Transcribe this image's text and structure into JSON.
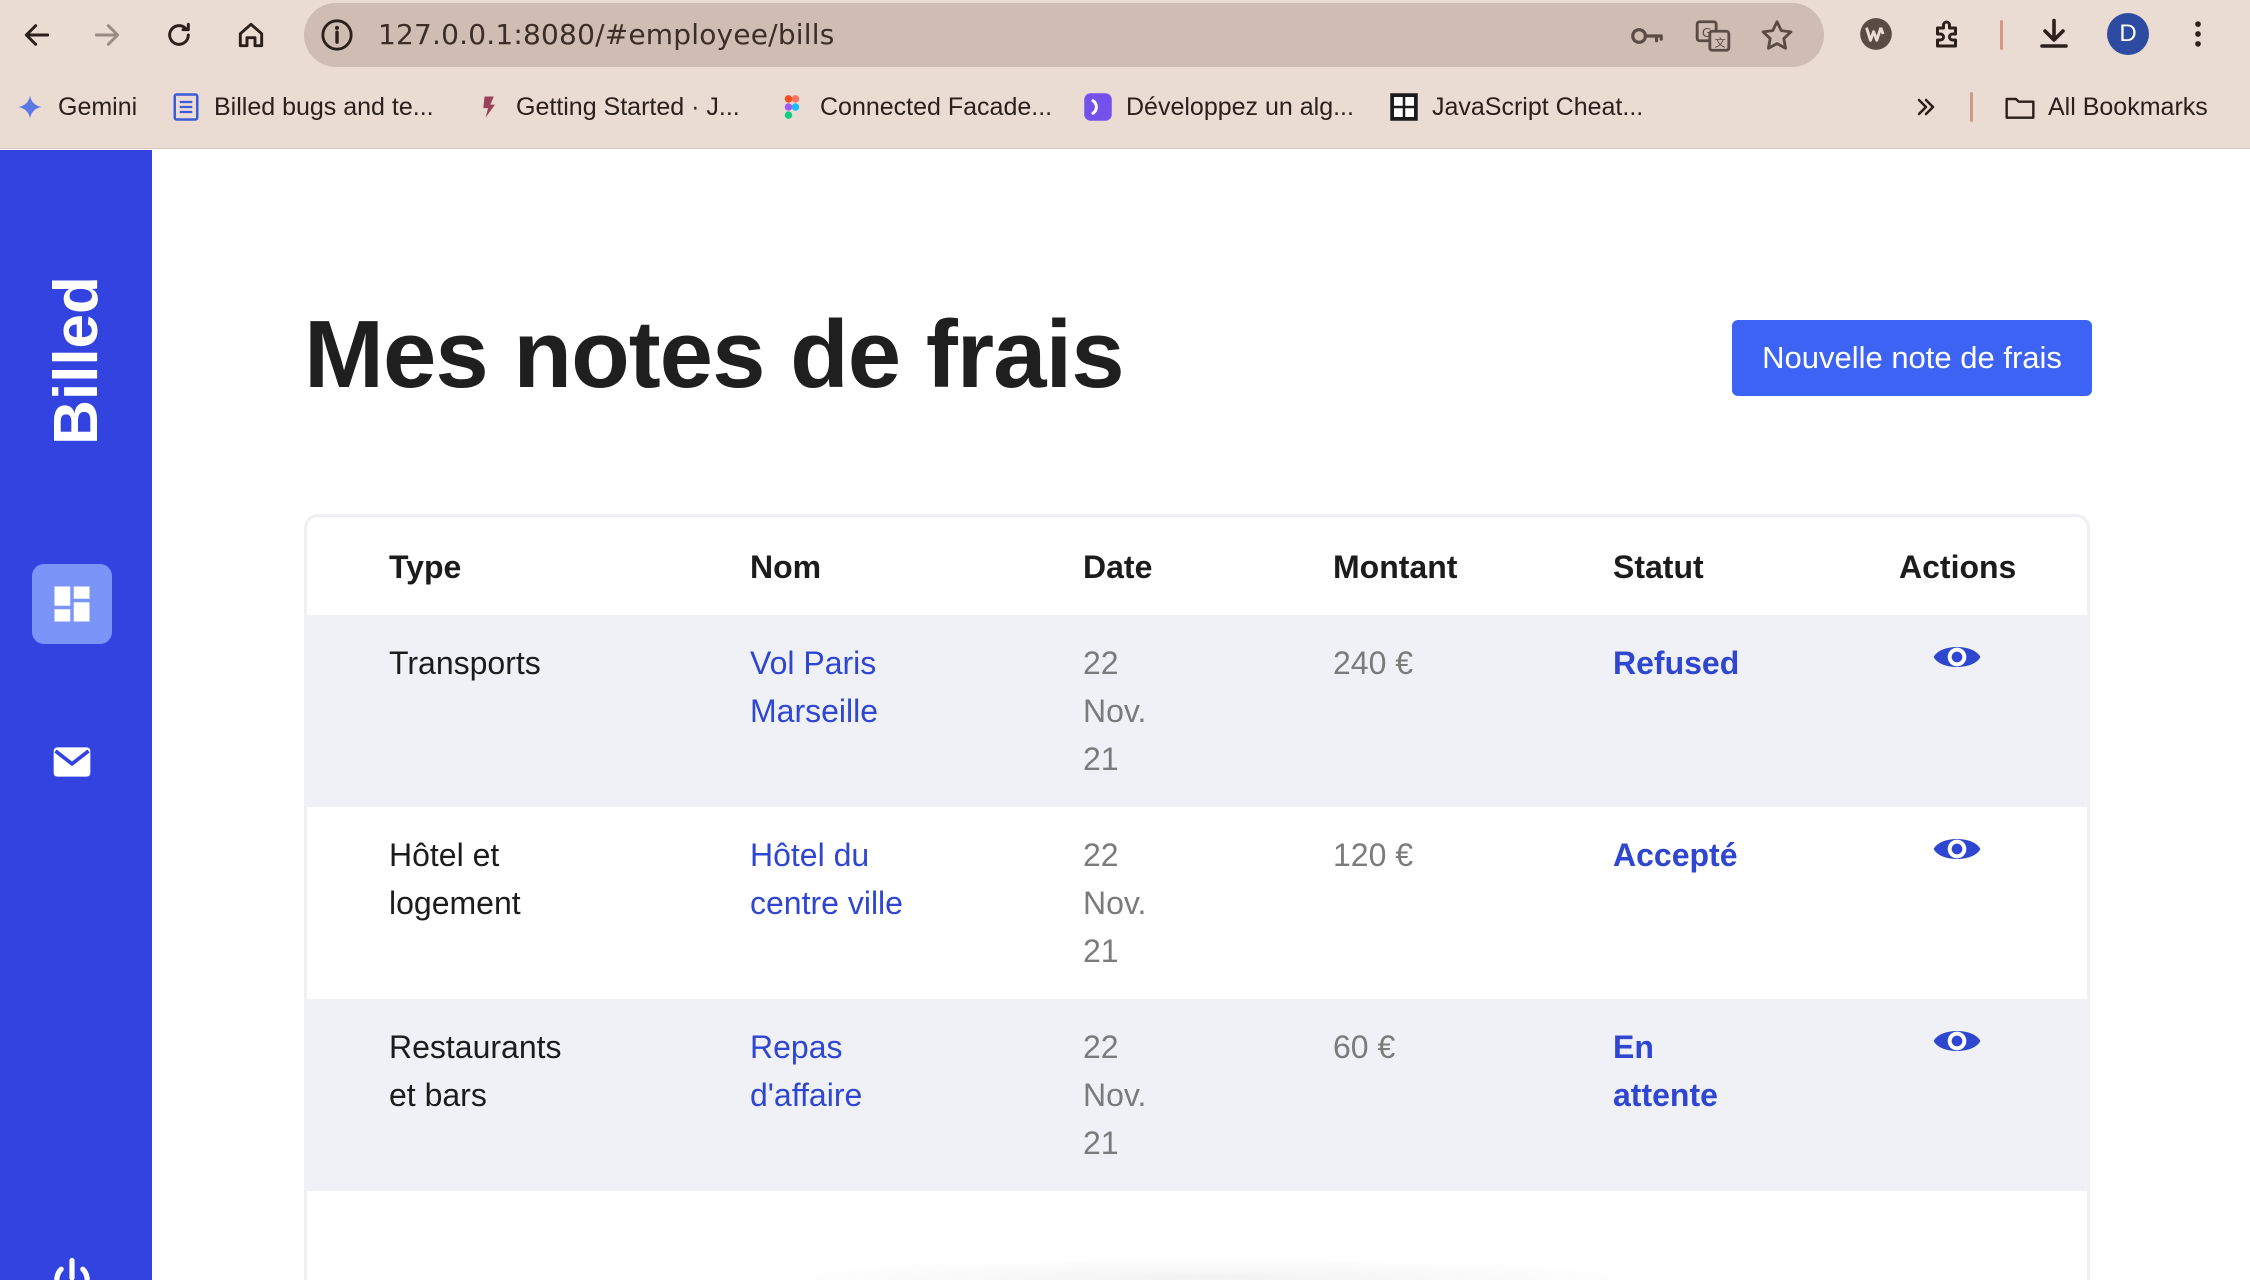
{
  "browser": {
    "url": "127.0.0.1:8080/#employee/bills",
    "avatar_letter": "D",
    "bookmarks": [
      {
        "label": "Gemini",
        "icon": "gemini-icon"
      },
      {
        "label": "Billed bugs and te...",
        "icon": "doc-icon"
      },
      {
        "label": "Getting Started · J...",
        "icon": "jest-icon"
      },
      {
        "label": "Connected Facade...",
        "icon": "figma-icon"
      },
      {
        "label": "Développez un alg...",
        "icon": "openclassrooms-icon"
      },
      {
        "label": "JavaScript Cheat...",
        "icon": "cheatsheet-icon"
      }
    ],
    "all_bookmarks": "All Bookmarks"
  },
  "sidebar": {
    "brand": "Billed",
    "accent": "#3343e0"
  },
  "page": {
    "title": "Mes notes de frais",
    "new_button": "Nouvelle note de frais"
  },
  "table": {
    "headers": {
      "type": "Type",
      "name": "Nom",
      "date": "Date",
      "amount": "Montant",
      "status": "Statut",
      "actions": "Actions"
    },
    "rows": [
      {
        "type": [
          "Transports"
        ],
        "name": [
          "Vol Paris",
          "Marseille"
        ],
        "date": [
          "22",
          "Nov.",
          "21"
        ],
        "amount": "240 €",
        "status": [
          "Refused"
        ]
      },
      {
        "type": [
          "Hôtel et",
          "logement"
        ],
        "name": [
          "Hôtel du",
          "centre ville"
        ],
        "date": [
          "22",
          "Nov.",
          "21"
        ],
        "amount": "120 €",
        "status": [
          "Accepté"
        ]
      },
      {
        "type": [
          "Restaurants",
          "et bars"
        ],
        "name": [
          "Repas",
          "d'affaire"
        ],
        "date": [
          "22",
          "Nov.",
          "21"
        ],
        "amount": "60 €",
        "status": [
          "En",
          "attente"
        ]
      }
    ]
  }
}
